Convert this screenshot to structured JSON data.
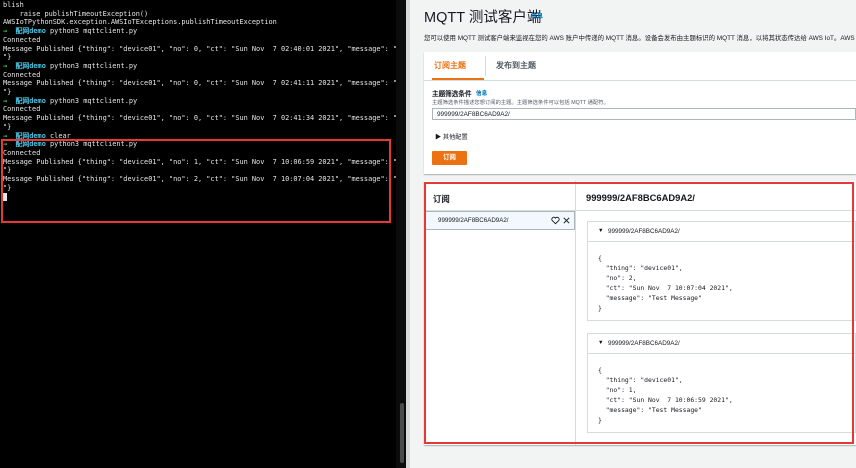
{
  "terminal": {
    "lines": [
      {
        "kind": "text",
        "text": "blish"
      },
      {
        "kind": "text",
        "text": "    raise publishTimeoutException()"
      },
      {
        "kind": "text",
        "text": "AWSIoTPythonSDK.exception.AWSIoTExceptions.publishTimeoutException"
      },
      {
        "kind": "prompt",
        "arrow": "→",
        "dir": "配网demo",
        "cmd": "python3 mqttclient.py"
      },
      {
        "kind": "text",
        "text": "Connected"
      },
      {
        "kind": "text",
        "text": "Message Published {\"thing\": \"device01\", \"no\": 0, \"ct\": \"Sun Nov  7 02:40:01 2021\", \"message\": \"Test Message"
      },
      {
        "kind": "text",
        "text": "\"}"
      },
      {
        "kind": "prompt",
        "arrow": "→",
        "dir": "配网demo",
        "cmd": "python3 mqttclient.py"
      },
      {
        "kind": "text",
        "text": "Connected"
      },
      {
        "kind": "text",
        "text": "Message Published {\"thing\": \"device01\", \"no\": 0, \"ct\": \"Sun Nov  7 02:41:11 2021\", \"message\": \"Test Message"
      },
      {
        "kind": "text",
        "text": "\"}"
      },
      {
        "kind": "prompt",
        "arrow": "→",
        "dir": "配网demo",
        "cmd": "python3 mqttclient.py"
      },
      {
        "kind": "text",
        "text": "Connected"
      },
      {
        "kind": "text",
        "text": "Message Published {\"thing\": \"device01\", \"no\": 0, \"ct\": \"Sun Nov  7 02:41:34 2021\", \"message\": \"Test Message"
      },
      {
        "kind": "text",
        "text": "\"}"
      },
      {
        "kind": "prompt",
        "arrow": "→",
        "dir": "配网demo",
        "cmd": "clear"
      },
      {
        "kind": "prompt",
        "arrow": "→",
        "dir": "配网demo",
        "cmd": "python3 mqttclient.py"
      },
      {
        "kind": "text",
        "text": "Connected"
      },
      {
        "kind": "text",
        "text": "Message Published {\"thing\": \"device01\", \"no\": 1, \"ct\": \"Sun Nov  7 10:06:59 2021\", \"message\": \"Test Message"
      },
      {
        "kind": "text",
        "text": "\"}"
      },
      {
        "kind": "text",
        "text": "Message Published {\"thing\": \"device01\", \"no\": 2, \"ct\": \"Sun Nov  7 10:07:04 2021\", \"message\": \"Test Message"
      },
      {
        "kind": "text",
        "text": "\"}"
      }
    ]
  },
  "console": {
    "title": "MQTT 测试客户端",
    "title_info": "信息",
    "description": "您可以使用 MQTT 测试客户端来监视在您的 AWS 账户中传递的 MQTT 消息。设备会发布由主题标识的 MQTT 消息，以将其状态传达给 AWS IoT。AWS Io",
    "tabs": [
      {
        "label": "订阅主题",
        "active": true
      },
      {
        "label": "发布到主题",
        "active": false
      }
    ],
    "filter": {
      "label": "主题筛选条件",
      "info": "信息",
      "description": "主题筛选条件描述您想订阅的主题。主题筛选条件可以包括 MQTT 通配符。",
      "value": "999999/2AF8BC6AD9A2/"
    },
    "extra_config": "▶  其他配置",
    "subscribe_button": "订阅",
    "subscriptions_header": "订阅",
    "subscriptions": [
      {
        "topic": "999999/2AF8BC6AD9A2/"
      }
    ],
    "selected_topic": "999999/2AF8BC6AD9A2/",
    "messages": [
      {
        "caret": "▼",
        "topic": "999999/2AF8BC6AD9A2/",
        "body": [
          "{",
          "  \"thing\": \"device01\",",
          "  \"no\": 2,",
          "  \"ct\": \"Sun Nov  7 10:07:04 2021\",",
          "  \"message\": \"Test Message\"",
          "}"
        ]
      },
      {
        "caret": "▼",
        "topic": "999999/2AF8BC6AD9A2/",
        "body": [
          "{",
          "  \"thing\": \"device01\",",
          "  \"no\": 1,",
          "  \"ct\": \"Sun Nov  7 10:06:59 2021\",",
          "  \"message\": \"Test Message\"",
          "}"
        ]
      }
    ]
  },
  "colors": {
    "accent": "#ec7211",
    "link": "#0073bb",
    "highlight_box": "#e53935",
    "prompt_arrow": "#3fd15a",
    "prompt_dir": "#49c6e5"
  },
  "icons": {
    "heart": "heart-icon",
    "close": "close-icon",
    "caret": "caret-down-icon",
    "expand": "caret-right-icon"
  }
}
